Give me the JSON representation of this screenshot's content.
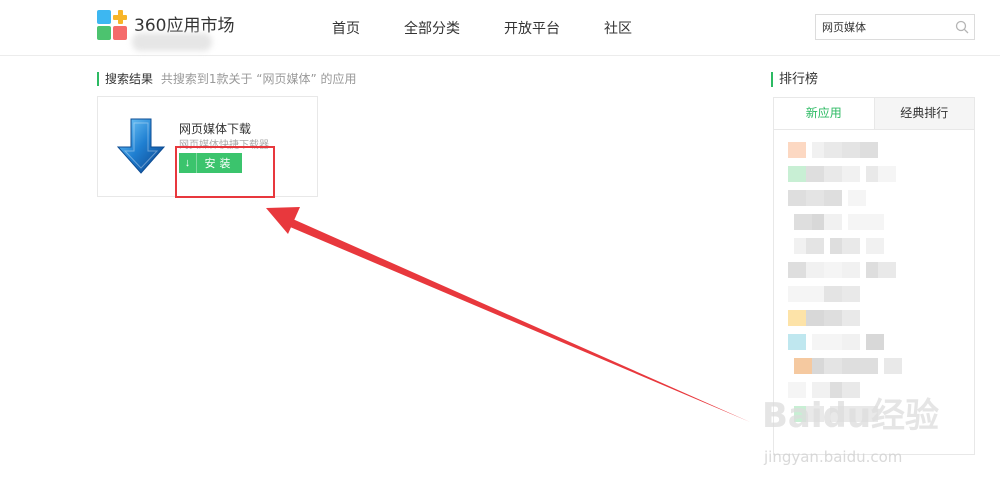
{
  "header": {
    "brand": "360应用市场",
    "nav": [
      "首页",
      "全部分类",
      "开放平台",
      "社区"
    ],
    "search_value": "网页媒体"
  },
  "results": {
    "title": "搜索结果",
    "summary": "共搜索到1款关于 “网页媒体” 的应用",
    "items": [
      {
        "name": "网页媒体下载",
        "desc": "网页媒体快捷下载器",
        "install_label": "安装"
      }
    ]
  },
  "ranking": {
    "title": "排行榜",
    "tabs": [
      "新应用",
      "经典排行"
    ],
    "active_tab": 0
  },
  "watermark": {
    "text": "Baidu经验",
    "url": "jingyan.baidu.com"
  },
  "colors": {
    "accent": "#2cba63",
    "install": "#3bc46d",
    "highlight": "#e8383d"
  }
}
